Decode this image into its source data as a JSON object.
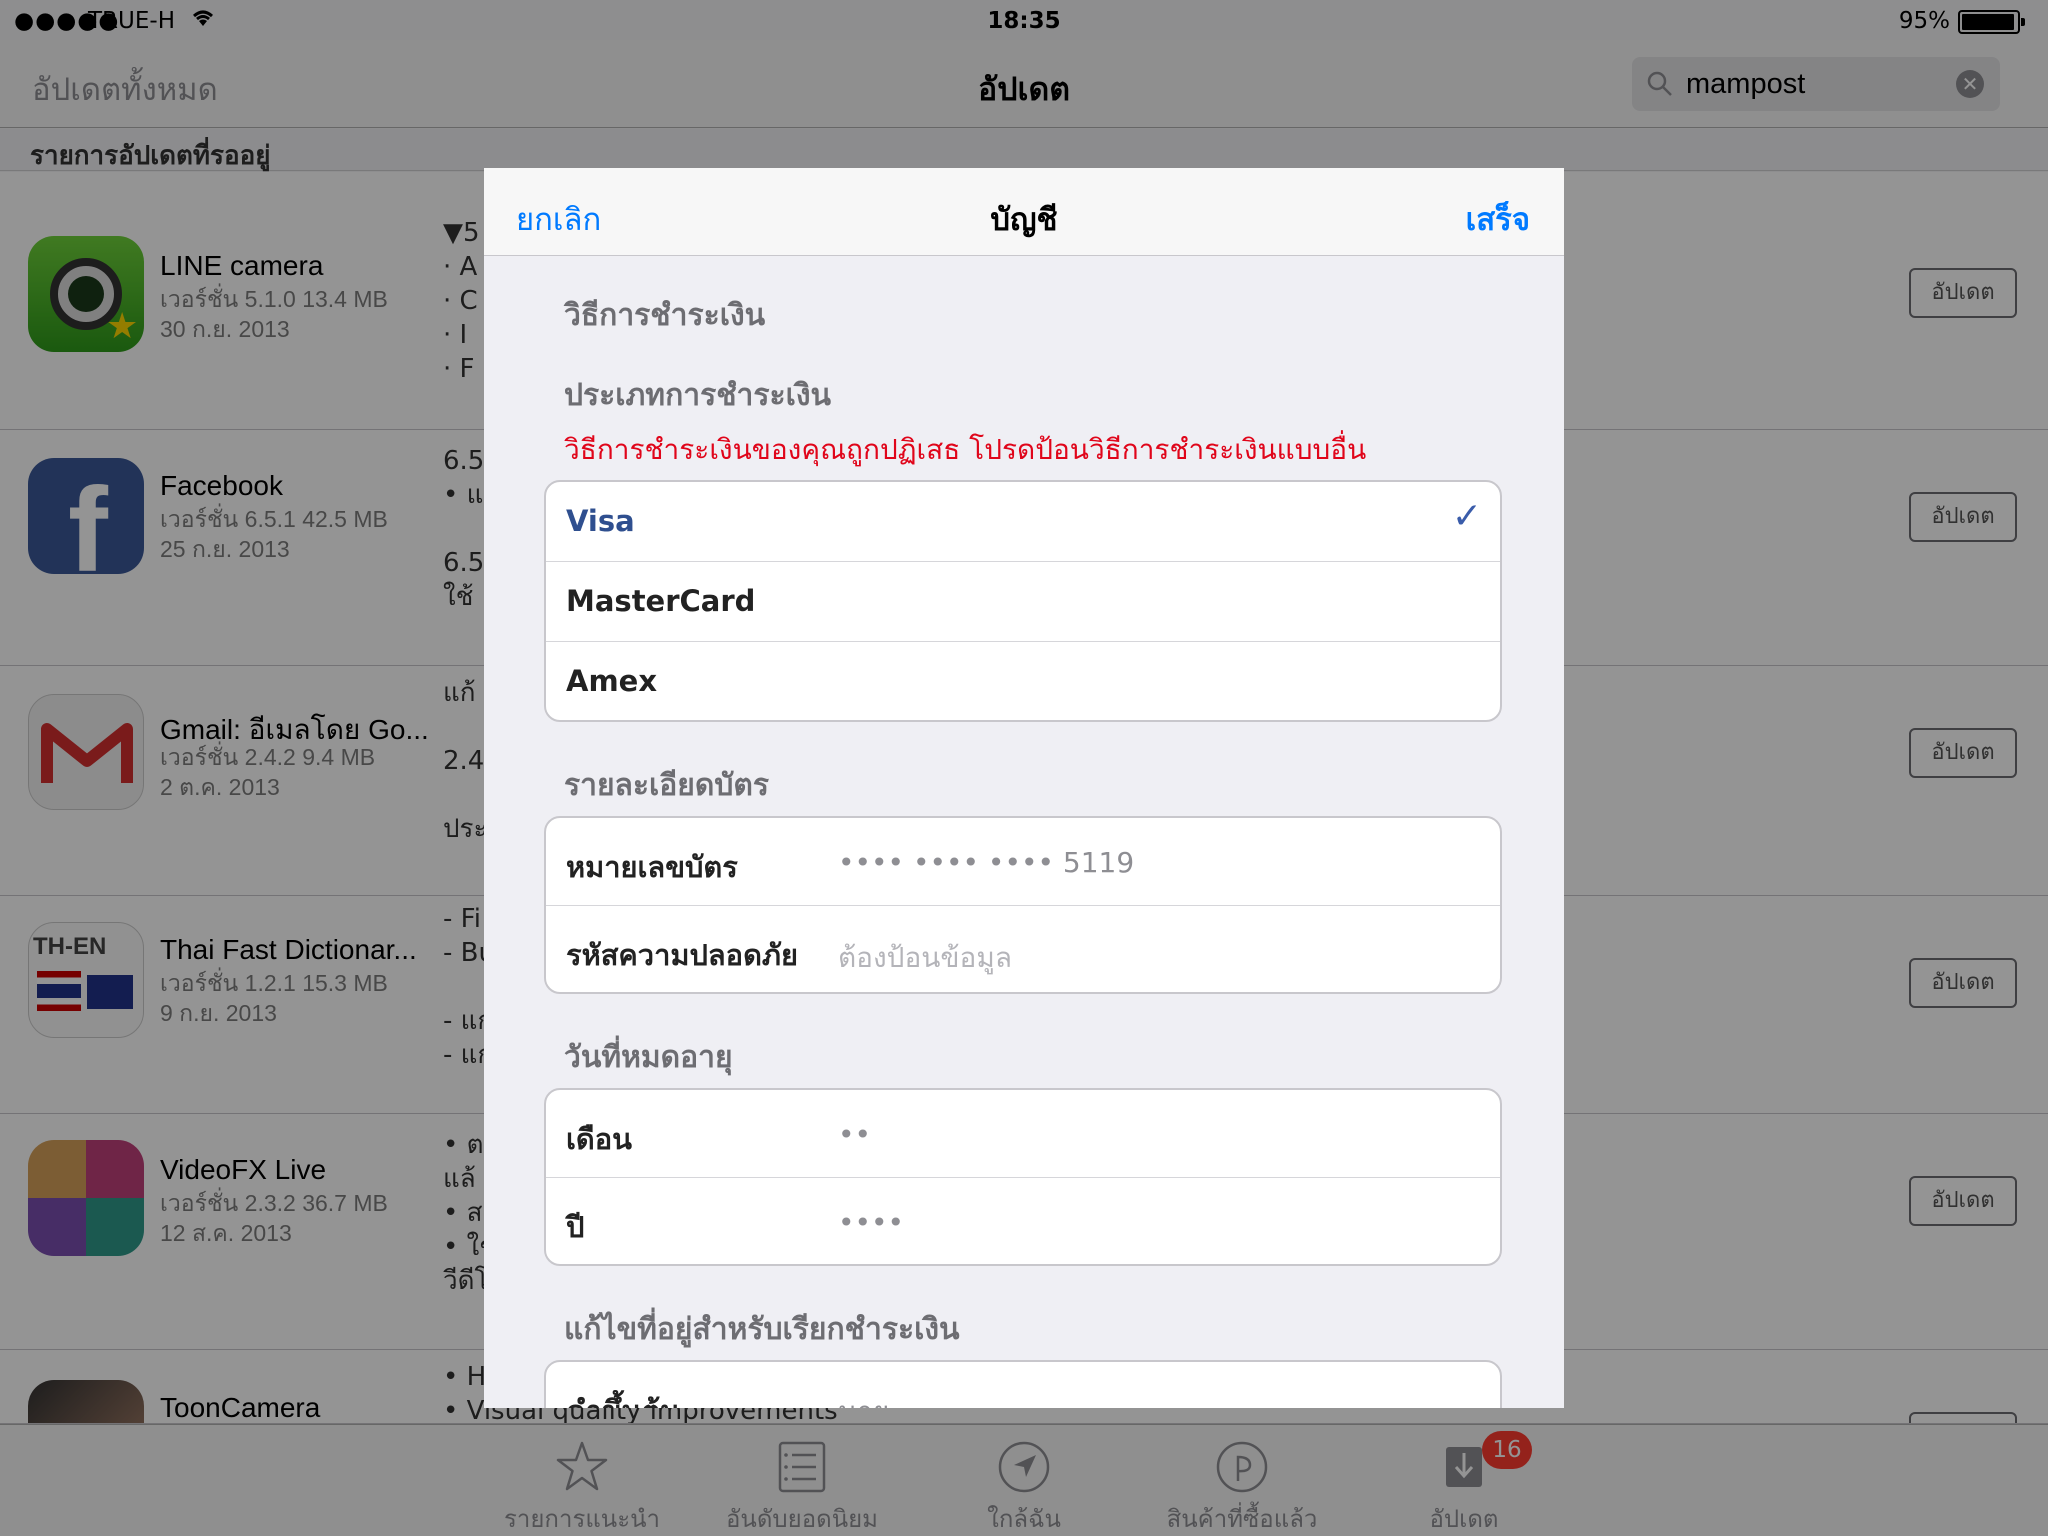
{
  "status_bar": {
    "signal": "●●●●●",
    "carrier": "TRUE-H",
    "time": "18:35",
    "battery": "95%"
  },
  "nav": {
    "left": "อัปเดตทั้งหมด",
    "title": "อัปเดต",
    "search_value": "mampost"
  },
  "section_header": "รายการอัปเดตที่รออยู่",
  "update_label": "อัปเดต",
  "apps": [
    {
      "name": "LINE camera",
      "version": "เวอร์ชั่น 5.1.0 13.4 MB",
      "date": "30 ก.ย. 2013",
      "notes": "▼5\n· A\n· C\n· I\n· F"
    },
    {
      "name": "Facebook",
      "version": "เวอร์ชั่น 6.5.1 42.5 MB",
      "date": "25 ก.ย. 2013",
      "notes": "6.5\n• แก\n\n6.5\nใช้ I"
    },
    {
      "name": "Gmail: อีเมลโดย Go...",
      "version": "เวอร์ชั่น 2.4.2 9.4 MB",
      "date": "2 ต.ค. 2013",
      "notes": "แก้\n\n2.4\n\nประ"
    },
    {
      "name": "Thai Fast Dictionar...",
      "version": "เวอร์ชั่น 1.2.1 15.3 MB",
      "date": "9 ก.ย. 2013",
      "notes": "- Fi\n- Bu\n\n- แก\n- แก"
    },
    {
      "name": "VideoFX Live",
      "version": "เวอร์ชั่น 2.3.2 36.7 MB",
      "date": "12 ส.ค. 2013",
      "notes": "• ตะ\nแล้\n• สา\n• ใช้\nวีดีโ"
    },
    {
      "name": "ToonCamera",
      "version": "",
      "date": "",
      "notes": "• Hi\n• Visual quality improvements"
    }
  ],
  "tabs": [
    {
      "label": "รายการแนะนำ",
      "icon": "star-icon"
    },
    {
      "label": "อันดับยอดนิยม",
      "icon": "list-icon"
    },
    {
      "label": "ใกล้ฉัน",
      "icon": "location-icon"
    },
    {
      "label": "สินค้าที่ซื้อแล้ว",
      "icon": "purchased-icon"
    },
    {
      "label": "อัปเดต",
      "icon": "updates-icon",
      "badge": "16"
    }
  ],
  "modal": {
    "cancel": "ยกเลิก",
    "title": "บัญชี",
    "done": "เสร็จ",
    "payment_method_title": "วิธีการชำระเงิน",
    "payment_type_title": "ประเภทการชำระเงิน",
    "error": "วิธีการชำระเงินของคุณถูกปฏิเสธ โปรดป้อนวิธีการชำระเงินแบบอื่น",
    "payment_options": [
      "Visa",
      "MasterCard",
      "Amex"
    ],
    "selected_option": "Visa",
    "card_details_title": "รายละเอียดบัตร",
    "card_number_label": "หมายเลขบัตร",
    "card_number_value": "•••• •••• •••• 5119",
    "security_code_label": "รหัสความปลอดภัย",
    "security_code_placeholder": "ต้องป้อนข้อมูล",
    "expiry_title": "วันที่หมดอายุ",
    "month_label": "เดือน",
    "month_value": "••",
    "year_label": "ปี",
    "year_value": "••••",
    "billing_title": "แก้ไขที่อยู่สำหรับเรียกชำระเงิน",
    "billing_first_label": "คำขึ้นต้น",
    "billing_first_value": "นาย"
  },
  "colors": {
    "accent": "#007aff",
    "error": "#e0051a",
    "badge": "#ff3b30"
  }
}
